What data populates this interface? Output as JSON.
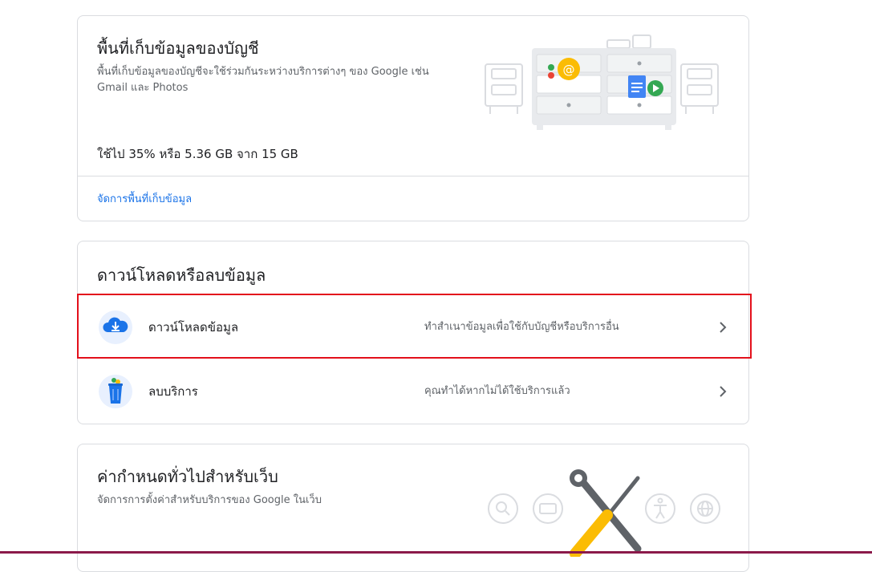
{
  "storage": {
    "title": "พื้นที่เก็บข้อมูลของบัญชี",
    "desc_line1": "พื้นที่เก็บข้อมูลของบัญชีจะใช้ร่วมกันระหว่างบริการต่างๆ ของ Google เช่น",
    "desc_line2": "Gmail และ Photos",
    "usage": "ใช้ไป 35% หรือ 5.36 GB จาก 15 GB",
    "usage_percent": 35,
    "manage_link": "จัดการพื้นที่เก็บข้อมูล",
    "illustration_icon": "storage-drawers-illustration"
  },
  "download_delete": {
    "title": "ดาวน์โหลดหรือลบข้อมูล",
    "rows": [
      {
        "label": "ดาวน์โหลดข้อมูล",
        "desc": "ทำสำเนาข้อมูลเพื่อใช้กับบัญชีหรือบริการอื่น",
        "icon": "cloud-download-icon"
      },
      {
        "label": "ลบบริการ",
        "desc": "คุณทำได้หากไม่ได้ใช้บริการแล้ว",
        "icon": "trash-bin-icon"
      }
    ]
  },
  "web_prefs": {
    "title": "ค่ากำหนดทั่วไปสำหรับเว็บ",
    "desc": "จัดการการตั้งค่าสำหรับบริการของ Google ในเว็บ",
    "illustration_icons": [
      "search-icon",
      "keyboard-icon",
      "tools-icon",
      "accessibility-icon",
      "globe-icon"
    ]
  },
  "colors": {
    "link": "#1a73e8",
    "highlight": "#e3101b",
    "border": "#dadce0"
  }
}
